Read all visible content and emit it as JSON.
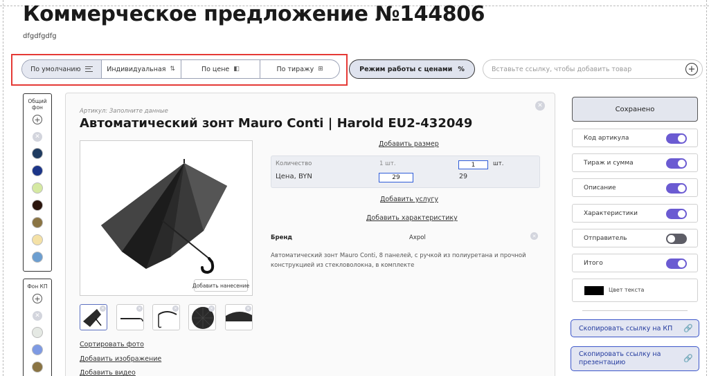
{
  "header": {
    "title": "Коммерческое предложение №144806",
    "subtitle": "dfgdfgdfg"
  },
  "sort": {
    "items": [
      {
        "label": "По умолчанию",
        "icon": "menu-icon"
      },
      {
        "label": "Индивидуальная",
        "icon": "sort-icon"
      },
      {
        "label": "По цене",
        "icon": "price-tag-icon"
      },
      {
        "label": "По тиражу",
        "icon": "grid-icon"
      }
    ]
  },
  "price_mode": {
    "label": "Режим работы с ценами",
    "icon_glyph": "%"
  },
  "add_product": {
    "placeholder": "Вставьте ссылку, чтобы добавить товар"
  },
  "bg_panels": {
    "common_label": "Общий фон",
    "kp_label": "Фон КП",
    "common_swatches": [
      "#1f3b60",
      "#1c3588",
      "#d5e9a2",
      "#2a150d",
      "#8a7443",
      "#f4e1a6",
      "#6c9ed0"
    ],
    "kp_swatches": [
      "#e5e9e4",
      "#7e9ae3",
      "#8a7443"
    ]
  },
  "product": {
    "article_label": "Артикул:",
    "article_placeholder": "Заполните данные",
    "title": "Автоматический зонт Mauro Conti | Harold EU2-432049",
    "branding_button": "Добавить нанесение",
    "add_size": "Добавить размер",
    "quantity_label": "Количество",
    "quantity_unit": "1 шт.",
    "quantity_value": "1",
    "quantity_suffix": "шт.",
    "price_label": "Цена, BYN",
    "price_value": "29",
    "price_total": "29",
    "add_service": "Добавить услугу",
    "add_feature": "Добавить характеристику",
    "brand_label": "Бренд",
    "brand_value": "Axpol",
    "description": "Автоматический зонт Mauro Conti, 8 панелей, с ручкой из полиуретана и прочной конструкцией из стекловолокна, в комплекте",
    "sort_photos": "Сортировать фото",
    "add_image": "Добавить изображение",
    "add_video": "Добавить видео"
  },
  "settings": {
    "saved_button": "Сохранено",
    "toggles": [
      {
        "label": "Код артикула",
        "on": true
      },
      {
        "label": "Тираж и сумма",
        "on": true
      },
      {
        "label": "Описание",
        "on": true
      },
      {
        "label": "Характеристики",
        "on": true
      },
      {
        "label": "Отправитель",
        "on": false
      },
      {
        "label": "Итого",
        "on": true
      }
    ],
    "text_color_label": "Цвет текста",
    "text_color": "#000000",
    "copy_kp": "Скопировать ссылку на КП",
    "copy_presentation": "Скопировать ссылку на презентацию"
  },
  "colors": {
    "accent_toggle": "#6b5bd2",
    "link_blue": "#3b55c9",
    "highlight_red": "#e53935"
  }
}
